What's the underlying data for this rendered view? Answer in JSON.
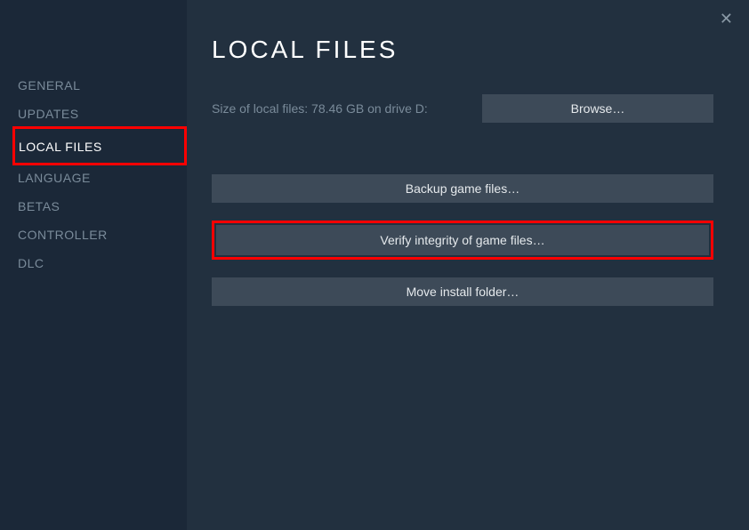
{
  "sidebar": {
    "items": [
      {
        "label": "GENERAL"
      },
      {
        "label": "UPDATES"
      },
      {
        "label": "LOCAL FILES"
      },
      {
        "label": "LANGUAGE"
      },
      {
        "label": "BETAS"
      },
      {
        "label": "CONTROLLER"
      },
      {
        "label": "DLC"
      }
    ]
  },
  "main": {
    "title": "LOCAL FILES",
    "size_text": "Size of local files: 78.46 GB on drive D:",
    "browse_label": "Browse…",
    "backup_label": "Backup game files…",
    "verify_label": "Verify integrity of game files…",
    "move_label": "Move install folder…"
  }
}
